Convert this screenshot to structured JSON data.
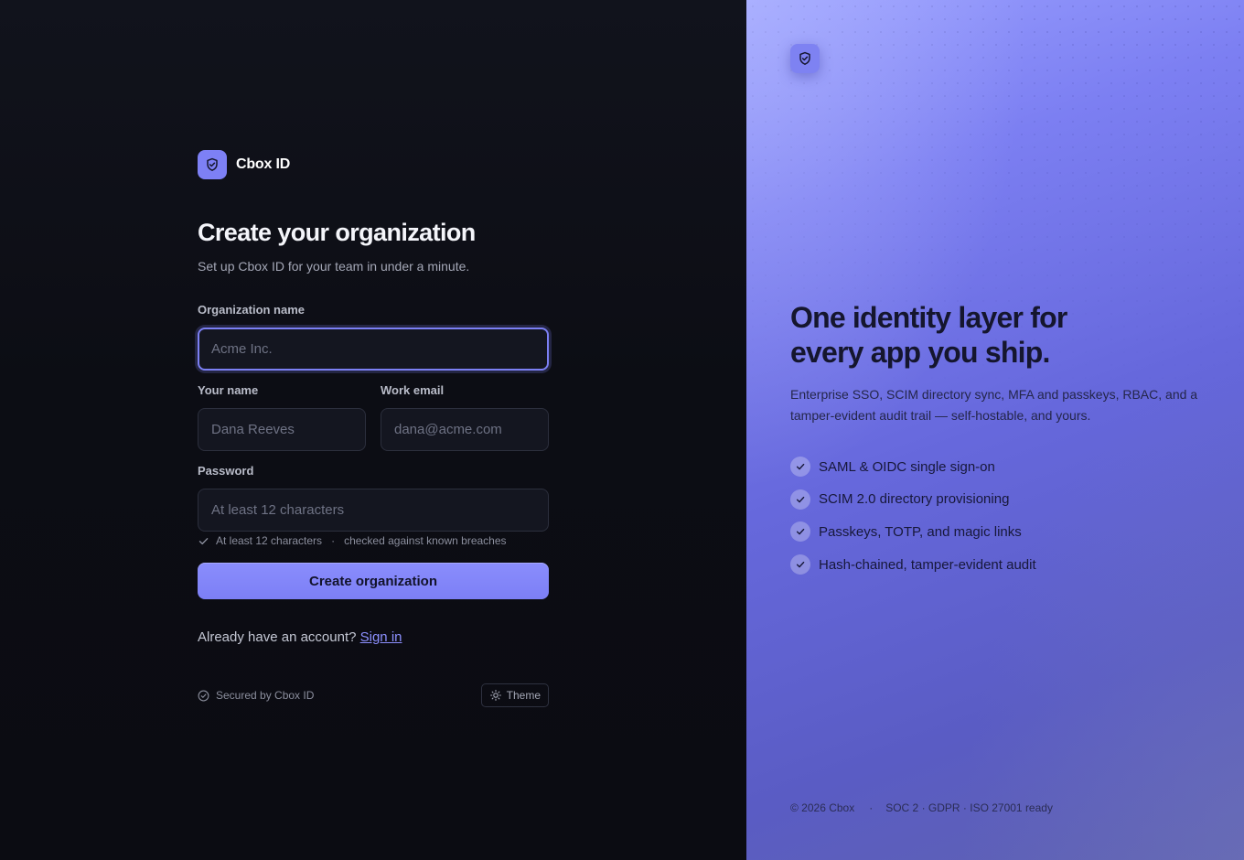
{
  "brand": {
    "name": "Cbox ID"
  },
  "form": {
    "title": "Create your organization",
    "subtitle": "Set up Cbox ID for your team in under a minute.",
    "org_name": {
      "label": "Organization name",
      "placeholder": "Acme Inc.",
      "value": ""
    },
    "your_name": {
      "label": "Your name",
      "placeholder": "Dana Reeves",
      "value": ""
    },
    "work_email": {
      "label": "Work email",
      "placeholder": "dana@acme.com",
      "value": ""
    },
    "password": {
      "label": "Password",
      "placeholder": "At least 12 characters",
      "value": ""
    },
    "password_hint": {
      "rule": "At least 12 characters",
      "separator": "·",
      "note": "checked against known breaches"
    },
    "submit_label": "Create organization",
    "signin_prompt": "Already have an account?",
    "signin_link": "Sign in"
  },
  "footer": {
    "secured": "Secured by Cbox ID",
    "theme_label": "Theme"
  },
  "hero": {
    "headline_line1": "One identity layer for",
    "headline_line2": "every app you ship.",
    "description": "Enterprise SSO, SCIM directory sync, MFA and passkeys, RBAC, and a tamper-evident audit trail — self-hostable, and yours.",
    "features": [
      "SAML & OIDC single sign-on",
      "SCIM 2.0 directory provisioning",
      "Passkeys, TOTP, and magic links",
      "Hash-chained, tamper-evident audit"
    ],
    "copyright": "© 2026 Cbox",
    "separator": "·",
    "compliance": "SOC 2 · GDPR · ISO 27001 ready"
  },
  "icons": {
    "logo": "shield-check-icon",
    "hint": "check-icon",
    "secured": "check-circle-icon",
    "theme": "sun-icon",
    "feature": "check-icon"
  },
  "colors": {
    "accent": "#7d80f5",
    "background": "#0b0c12",
    "hero_gradient_start": "#9aa0ff",
    "hero_gradient_end": "#5f62b0",
    "link": "#8d90ff"
  }
}
